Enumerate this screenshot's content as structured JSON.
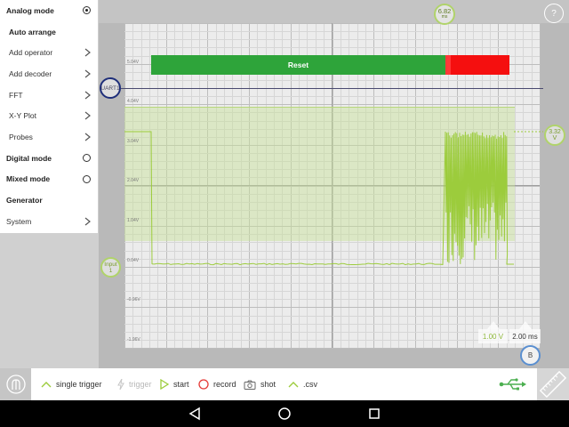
{
  "sidebar": {
    "items": [
      {
        "label": "Analog mode",
        "control": "radio-on"
      },
      {
        "label": "Auto arrange",
        "control": "none"
      },
      {
        "label": "Add operator",
        "control": "chevron"
      },
      {
        "label": "Add decoder",
        "control": "chevron"
      },
      {
        "label": "FFT",
        "control": "chevron"
      },
      {
        "label": "X-Y Plot",
        "control": "chevron"
      },
      {
        "label": "Probes",
        "control": "chevron"
      },
      {
        "label": "Digital mode",
        "control": "radio-off"
      },
      {
        "label": "Mixed mode",
        "control": "radio-off"
      },
      {
        "label": "Generator",
        "control": "none"
      },
      {
        "label": "System",
        "control": "chevron"
      }
    ]
  },
  "scope": {
    "y_axis_labels": [
      "5.04V",
      "4.04V",
      "3.04V",
      "2.04V",
      "1.04V",
      "0.04V",
      "-0.96V",
      "-1.96V"
    ],
    "decoder": {
      "marker_label": "UART1",
      "bar_label": "Reset",
      "ok_color": "#2ea43a",
      "error_color": "#f50f0f"
    },
    "input_marker": {
      "line1": "Input",
      "line2": "1"
    },
    "voltage_marker": "3.32\nV",
    "time_marker": {
      "value": "6.82",
      "unit": "ms"
    },
    "b_marker": "B",
    "help": "?",
    "volt_scale": "1.00 V",
    "time_scale": "2.00 ms",
    "signal_color": "#9ccc3c"
  },
  "toolbar": {
    "single_trigger": "single trigger",
    "trigger": "trigger",
    "start": "start",
    "record": "record",
    "shot": "shot",
    "csv": ".csv"
  },
  "icons": {
    "logo": "probe-logo-icon",
    "usb": "usb-icon",
    "ruler": "ruler-icon",
    "back": "back-triangle-icon",
    "home": "home-circle-icon",
    "recents": "recents-square-icon"
  }
}
